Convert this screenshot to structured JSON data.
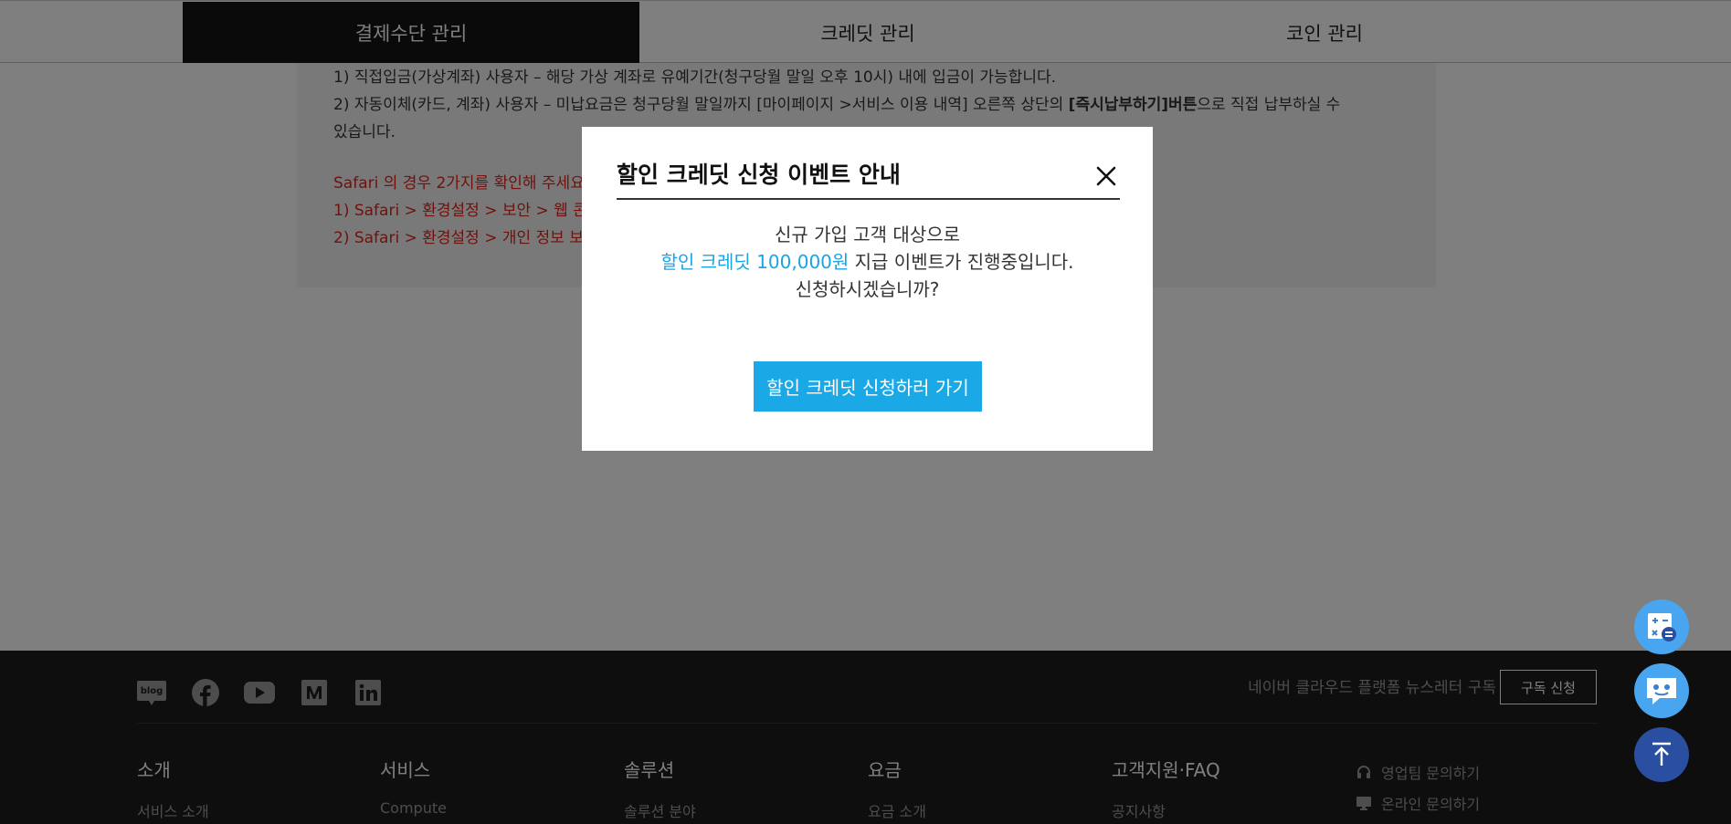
{
  "tabs": [
    {
      "label": "결제수단 관리",
      "active": true
    },
    {
      "label": "크레딧 관리",
      "active": false
    },
    {
      "label": "코인 관리",
      "active": false
    }
  ],
  "notice": {
    "line1": "1) 직접입금(가상계좌) 사용자 – 해당 가상 계좌로 유예기간(청구당월 말일 오후 10시) 내에 입금이 가능합니다.",
    "line2_pre": "2) 자동이체(카드, 계좌) 사용자 – 미납요금은 청구당월 말일까지 [마이페이지 >서비스 이용 내역] 오른쪽 상단의 ",
    "line2_bold": "[즉시납부하기]버튼",
    "line2_post": "으로 직접 납부하실 수",
    "line3": "있습니다.",
    "safari_title": "Safari 의 경우 2가지를 확인해 주세요",
    "safari_1": "1) Safari > 환경설정 > 보안 > 웹 콘",
    "safari_2": "2) Safari > 환경설정 > 개인 정보 보"
  },
  "modal": {
    "title": "할인 크레딧 신청 이벤트 안내",
    "line1": "신규 가입 고객 대상으로",
    "line2_highlight": "할인 크레딧 100,000원",
    "line2_rest": " 지급 이벤트가 진행중입니다.",
    "line3": "신청하시겠습니까?",
    "cta_label": "할인 크레딧 신청하러 가기"
  },
  "footer": {
    "social": [
      "blog-icon",
      "facebook-icon",
      "youtube-icon",
      "medium-icon",
      "linkedin-icon"
    ],
    "blog_text": "blog",
    "newsletter_text": "네이버 클라우드 플랫폼 뉴스레터 구독",
    "subscribe_label": "구독 신청",
    "columns": [
      {
        "title": "소개",
        "link": "서비스 소개"
      },
      {
        "title": "서비스",
        "link": "Compute"
      },
      {
        "title": "솔루션",
        "link": "솔루션 분야"
      },
      {
        "title": "요금",
        "link": "요금 소개"
      },
      {
        "title": "고객지원·FAQ",
        "link": "공지사항"
      }
    ],
    "contact_sales": "영업팀 문의하기",
    "contact_online": "온라인 문의하기"
  },
  "colors": {
    "accent": "#1aa8e6",
    "highlight_text": "#1aa4e4",
    "warning_red": "#e0241b",
    "float_top": "#2a4fa0",
    "float_light": "#4aa5f0"
  },
  "floating": [
    "calculator-icon",
    "chatbot-icon",
    "scroll-top-icon"
  ]
}
